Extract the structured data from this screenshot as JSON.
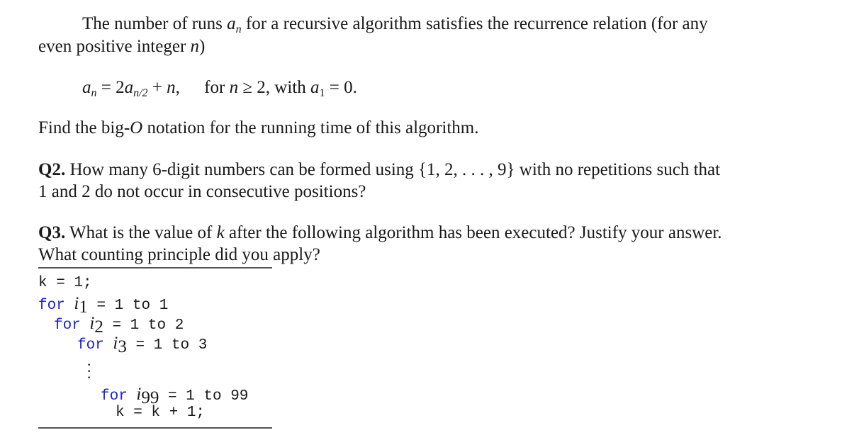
{
  "q1": {
    "intro_line1_a": "The number of runs ",
    "var_a": "a",
    "sub_n": "n",
    "intro_line1_b": " for a recursive algorithm satisfies the recurrence relation (for any",
    "intro_line2_a": "even positive integer ",
    "var_n": "n",
    "intro_line2_b": ")",
    "eq_lhs_sub": "n",
    "eq_mid": " = 2",
    "eq_sub2": "n/2",
    "eq_plus": " + ",
    "eq_comma": ",",
    "eq_cond_a": "for ",
    "eq_cond_ge": " ≥ 2,  with ",
    "eq_a1_sub": "1",
    "eq_end": " = 0.",
    "find": "Find the big-",
    "find_O": "O",
    "find_b": " notation for the running time of this algorithm."
  },
  "q2": {
    "label": "Q2.",
    "line1": " How many 6-digit numbers can be formed using {1, 2, . . . , 9} with no repetitions such that",
    "line2": "1 and 2 do not occur in consecutive positions?"
  },
  "q3": {
    "label": "Q3.",
    "line1_a": " What is the value of ",
    "var_k": "k",
    "line1_b": " after the following algorithm has been executed? Justify your answer.",
    "line2": "What counting principle did you apply?",
    "code": {
      "init": "k = 1;",
      "kw": "for",
      "i": "i",
      "loops": [
        {
          "sub": "1",
          "range": " = 1 to 1"
        },
        {
          "sub": "2",
          "range": " = 1 to 2"
        },
        {
          "sub": "3",
          "range": " = 1 to 3"
        },
        {
          "sub": "99",
          "range": " = 1 to 99"
        }
      ],
      "body": "k = k + 1;"
    }
  }
}
